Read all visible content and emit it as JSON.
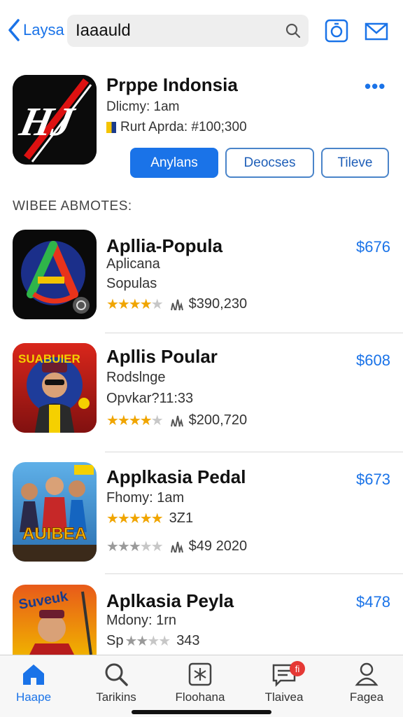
{
  "header": {
    "back_label": "Laysa",
    "search_value": "Iaaauld"
  },
  "featured": {
    "title": "Prppe Indonsia",
    "subtitle": "Dlicmy: 1am",
    "rank": "Rurt Aprda: #100;300",
    "more": "•••",
    "buttons": [
      "Anylans",
      "Deocses",
      "Tileve"
    ]
  },
  "section_title": "WIBEE ABMOTES:",
  "apps": [
    {
      "title": "Apllia-Popula",
      "line1": "Aplicana",
      "line2": "Sopulas",
      "stats": "$390,230",
      "price": "$676",
      "rating": 3.5
    },
    {
      "title": "Apllis Poular",
      "line1": "Rodslnge",
      "line2": "Opvkar?11:33",
      "stats": "$200,720",
      "price": "$608",
      "rating": 3.5
    },
    {
      "title": "Applkasia Pedal",
      "line1": "Fhomy: 1am",
      "line2": "3Z1",
      "stats": "$49 2020",
      "price": "$673",
      "rating": 4.5
    },
    {
      "title": "Aplkasia Peyla",
      "line1": "Mdony: 1rn",
      "line2": "Sp",
      "stats": "343",
      "price": "$478",
      "rating": 2
    }
  ],
  "tabs": [
    {
      "label": "Haape",
      "icon": "home-icon",
      "active": true
    },
    {
      "label": "Tarikins",
      "icon": "search-icon",
      "active": false
    },
    {
      "label": "Floohana",
      "icon": "star-box-icon",
      "active": false
    },
    {
      "label": "Tlaivea",
      "icon": "chat-icon",
      "active": false,
      "badge": "fi"
    },
    {
      "label": "Fagea",
      "icon": "person-icon",
      "active": false
    }
  ],
  "colors": {
    "accent": "#1a73e8",
    "star": "#f0a500",
    "badge": "#e53935"
  }
}
